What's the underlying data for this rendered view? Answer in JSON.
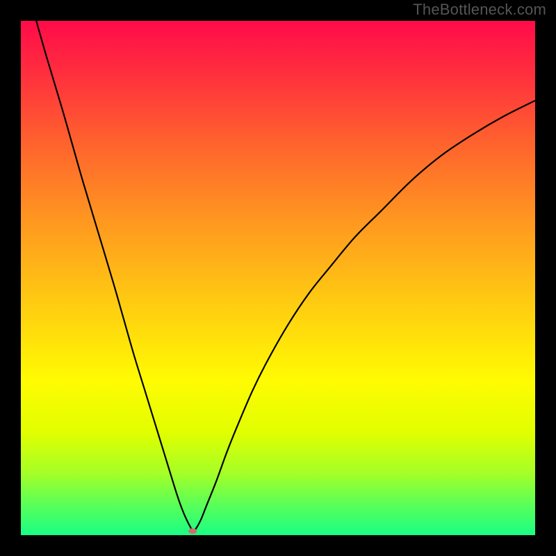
{
  "watermark": "TheBottleneck.com",
  "chart_data": {
    "type": "line",
    "title": "",
    "xlabel": "",
    "ylabel": "",
    "xlim": [
      0,
      100
    ],
    "ylim": [
      0,
      100
    ],
    "grid": false,
    "legend": false,
    "background_gradient": [
      {
        "pos": 0.0,
        "color": "#ff0b49"
      },
      {
        "pos": 0.1,
        "color": "#ff2e3e"
      },
      {
        "pos": 0.25,
        "color": "#ff672c"
      },
      {
        "pos": 0.4,
        "color": "#ff9b1f"
      },
      {
        "pos": 0.55,
        "color": "#ffcc11"
      },
      {
        "pos": 0.7,
        "color": "#fffb02"
      },
      {
        "pos": 0.8,
        "color": "#e1ff00"
      },
      {
        "pos": 0.88,
        "color": "#a4ff27"
      },
      {
        "pos": 0.94,
        "color": "#5bff58"
      },
      {
        "pos": 1.0,
        "color": "#19ff85"
      }
    ],
    "series": [
      {
        "name": "bottleneck-curve",
        "color": "#000000",
        "x": [
          3,
          5,
          8,
          10,
          12,
          15,
          18,
          20,
          22,
          24,
          26,
          28,
          30,
          31,
          32,
          33,
          33.5,
          34,
          35,
          36,
          38,
          40,
          42,
          45,
          48,
          52,
          56,
          60,
          65,
          70,
          76,
          82,
          88,
          94,
          100
        ],
        "y": [
          100,
          93,
          83,
          76,
          69,
          59,
          49,
          42,
          35,
          28.5,
          22,
          15.5,
          9,
          6,
          3.5,
          1.5,
          0.8,
          1.2,
          3,
          5.5,
          10.5,
          16,
          21,
          28,
          34,
          41,
          47,
          52,
          58,
          63,
          69,
          74,
          78,
          81.5,
          84.5
        ]
      }
    ],
    "marker": {
      "name": "optimal-point",
      "x": 33.4,
      "y": 0.8,
      "color": "#cc6e6c",
      "rx": 6,
      "ry": 4
    }
  }
}
